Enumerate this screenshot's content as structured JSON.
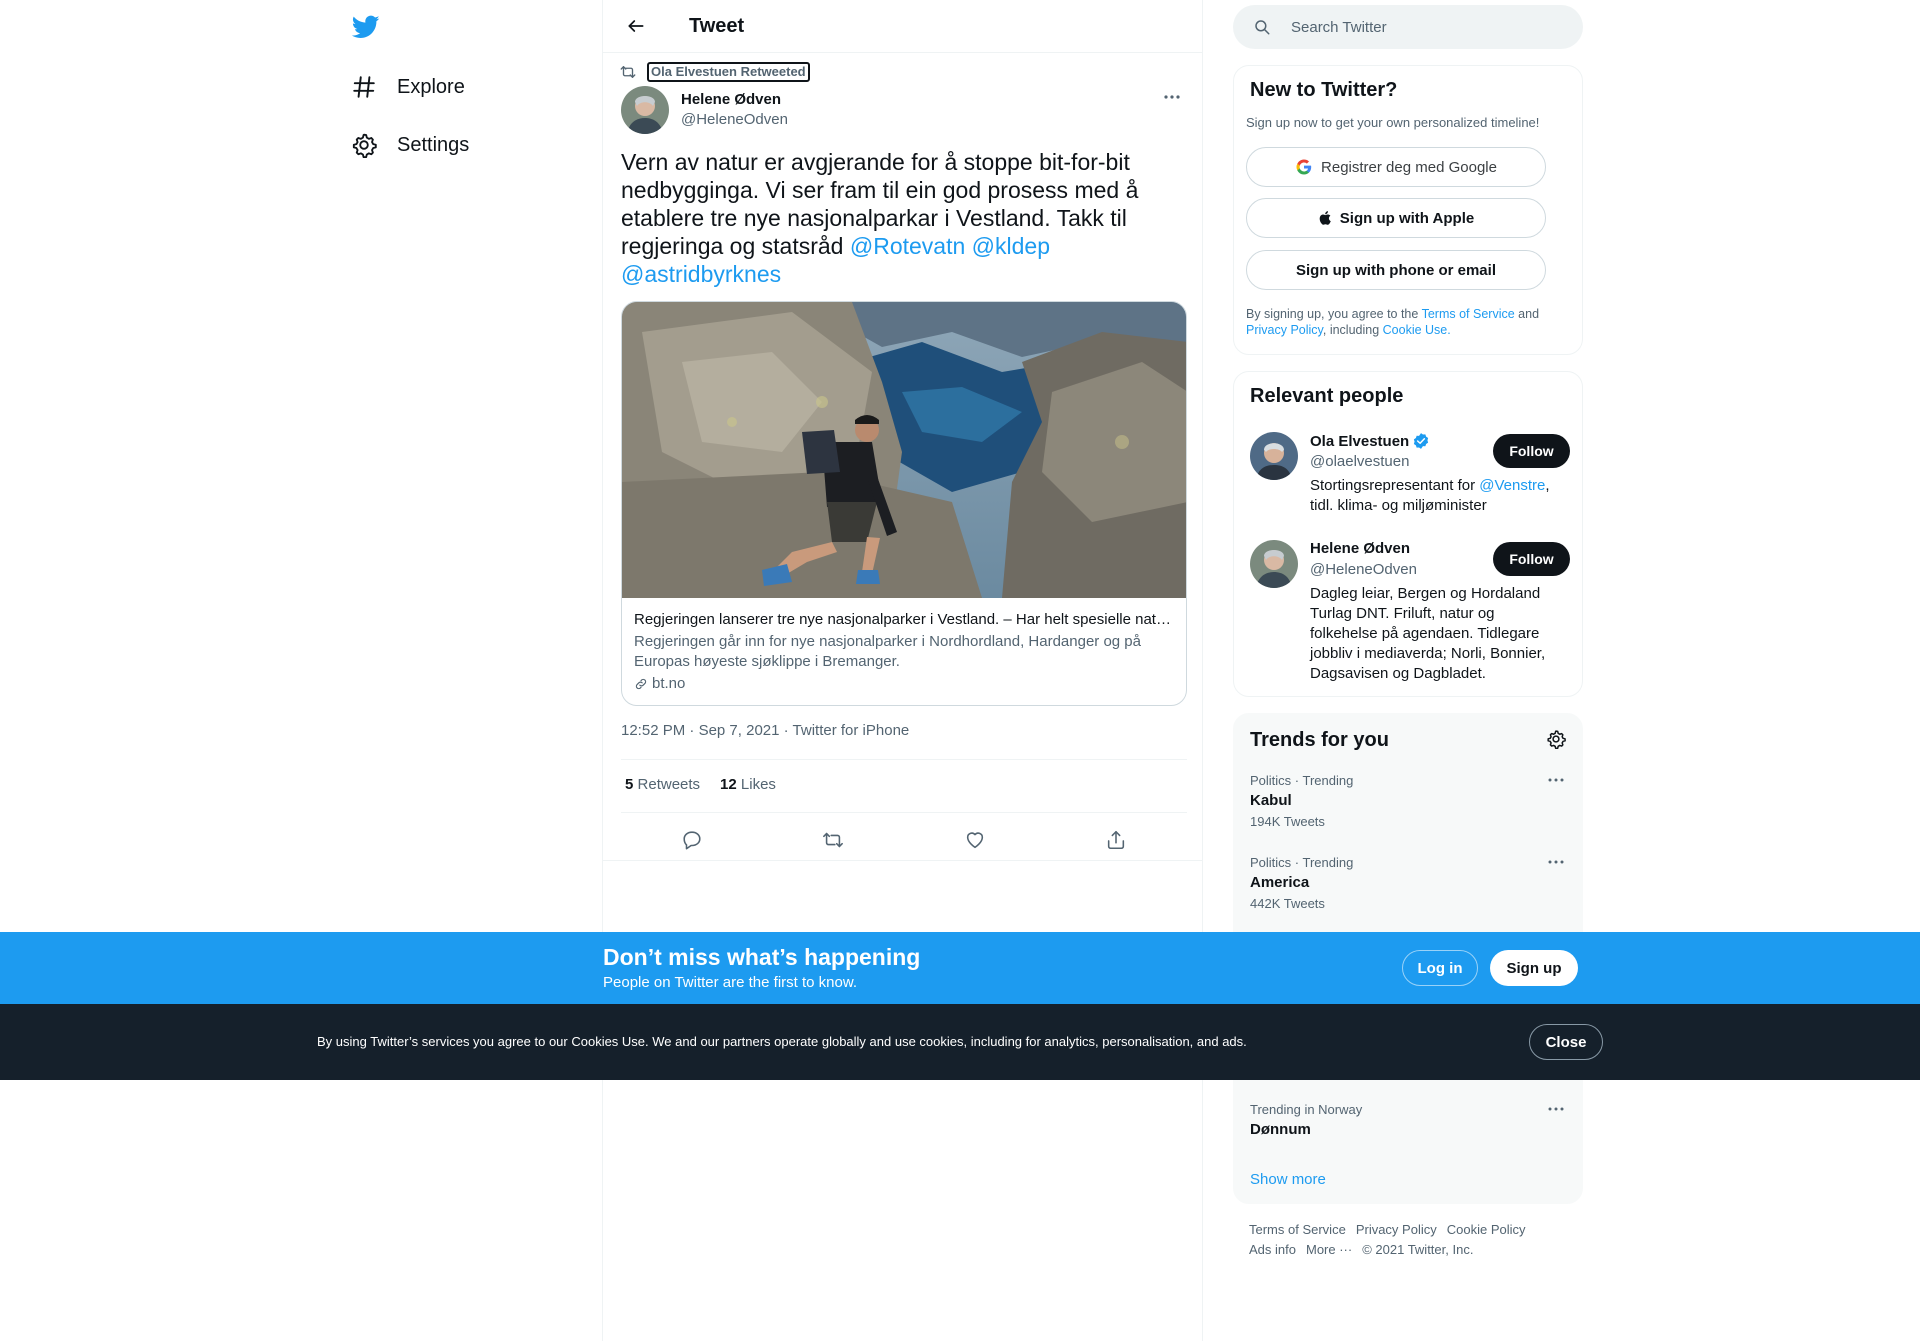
{
  "nav": {
    "items": [
      {
        "label": "Explore",
        "icon": "hashtag-icon"
      },
      {
        "label": "Settings",
        "icon": "gear-icon"
      }
    ]
  },
  "header": {
    "title": "Tweet"
  },
  "tweet": {
    "retweeted_by": "Ola Elvestuen Retweeted",
    "author_name": "Helene Ødven",
    "author_handle": "@HeleneOdven",
    "text": "Vern av natur er avgjerande for å stoppe bit-for-bit nedbygginga. Vi ser fram til ein god prosess med å etablere tre nye nasjonalparkar i Vestland. Takk til regjeringa og statsråd ",
    "mentions": [
      "@Rotevatn",
      "@kldep",
      "@astridbyrknes"
    ],
    "card": {
      "title": "Regjeringen lanserer tre nye nasjonalparker i Vestland. – Har helt spesielle natu…",
      "description": "Regjeringen går inn for nye nasjonalparker i Nordhordland, Hardanger og på Europas høyeste sjøklippe i Bremanger.",
      "domain": "bt.no"
    },
    "time": "12:52 PM",
    "date": "Sep 7, 2021",
    "source": "Twitter for iPhone",
    "retweets_count": "5",
    "retweets_label": "Retweets",
    "likes_count": "12",
    "likes_label": "Likes"
  },
  "search": {
    "placeholder": "Search Twitter"
  },
  "new_to_twitter": {
    "title": "New to Twitter?",
    "subtitle": "Sign up now to get your own personalized timeline!",
    "google_label": "Registrer deg med Google",
    "apple_label": "Sign up with Apple",
    "phone_label": "Sign up with phone or email",
    "legal_prefix": "By signing up, you agree to the ",
    "terms": "Terms of Service",
    "and": " and ",
    "privacy": "Privacy Policy",
    "including": ", including ",
    "cookie": "Cookie Use."
  },
  "relevant_people": {
    "title": "Relevant people",
    "people": [
      {
        "name": "Ola Elvestuen",
        "handle": "@olaelvestuen",
        "verified": true,
        "bio_prefix": "Stortingsrepresentant for ",
        "bio_mention": "@Venstre",
        "bio_suffix": ", tidl. klima- og miljøminister",
        "follow_label": "Follow"
      },
      {
        "name": "Helene Ødven",
        "handle": "@HeleneOdven",
        "verified": false,
        "bio": "Dagleg leiar, Bergen og Hordaland Turlag DNT. Friluft, natur og folkehelse på agendaen. Tidlegare jobbliv i mediaverda; Norli, Bonnier, Dagsavisen og Dagbladet.",
        "follow_label": "Follow"
      }
    ]
  },
  "trends": {
    "title": "Trends for you",
    "items": [
      {
        "category": "Politics · Trending",
        "name": "Kabul",
        "count": "194K Tweets"
      },
      {
        "category": "Politics · Trending",
        "name": "America",
        "count": "442K Tweets"
      },
      {
        "category": "Trending in Norway",
        "name": "Dønnum",
        "count": ""
      }
    ],
    "show_more": "Show more"
  },
  "footer": {
    "links": [
      "Terms of Service",
      "Privacy Policy",
      "Cookie Policy",
      "Ads info",
      "More ···",
      "© 2021 Twitter, Inc."
    ]
  },
  "login_bar": {
    "title": "Don’t miss what’s happening",
    "subtitle": "People on Twitter are the first to know.",
    "login_label": "Log in",
    "signup_label": "Sign up"
  },
  "cookie_bar": {
    "text": "By using Twitter’s services you agree to our Cookies Use. We and our partners operate globally and use cookies, including for analytics, personalisation, and ads.",
    "close_label": "Close"
  },
  "colors": {
    "accent": "#1d9bf0",
    "text": "#0f1419",
    "secondary": "#536471",
    "cookie_bg": "#15202b"
  }
}
